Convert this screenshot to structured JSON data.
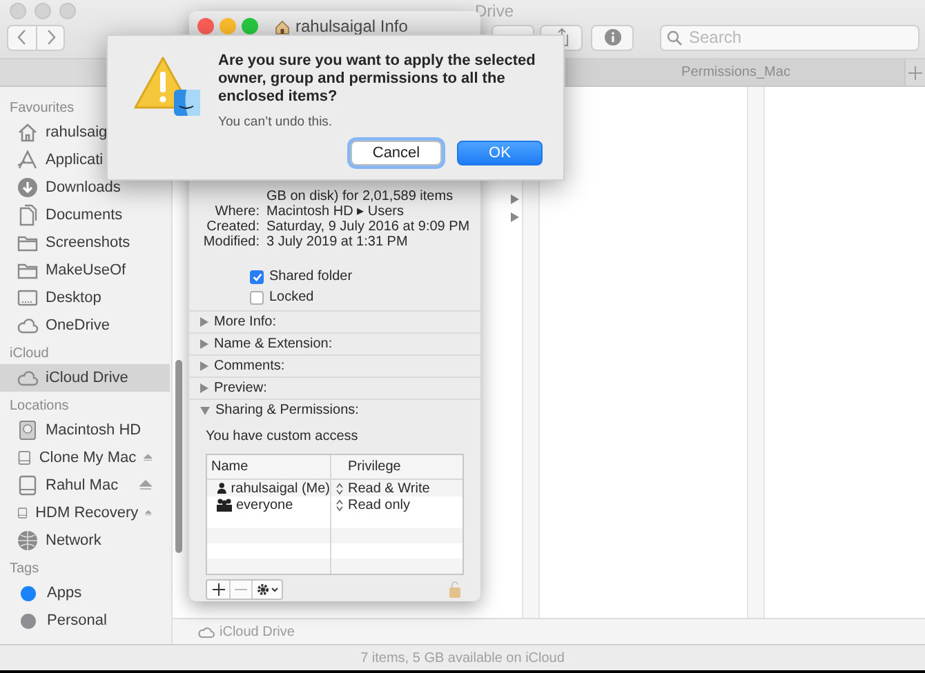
{
  "finder": {
    "title": "Drive",
    "search": {
      "placeholder": "Search"
    },
    "path_tab": "Permissions_Mac",
    "sidebar": [
      {
        "heading": "Favourites",
        "items": [
          {
            "label": "rahulsaig",
            "selected": false
          },
          {
            "label": "Applicati",
            "selected": false
          },
          {
            "label": "Downloads",
            "selected": false
          },
          {
            "label": "Documents",
            "selected": false
          },
          {
            "label": "Screenshots",
            "selected": false
          },
          {
            "label": "MakeUseOf",
            "selected": false
          },
          {
            "label": "Desktop",
            "selected": false
          },
          {
            "label": "OneDrive",
            "selected": false
          }
        ]
      },
      {
        "heading": "iCloud",
        "items": [
          {
            "label": "iCloud Drive",
            "selected": true
          }
        ]
      },
      {
        "heading": "Locations",
        "items": [
          {
            "label": "Macintosh HD",
            "selected": false,
            "ejectable": false
          },
          {
            "label": "Clone My Mac",
            "selected": false,
            "ejectable": true
          },
          {
            "label": "Rahul Mac",
            "selected": false,
            "ejectable": true
          },
          {
            "label": "HDM Recovery",
            "selected": false,
            "ejectable": true
          },
          {
            "label": "Network",
            "selected": false,
            "ejectable": false
          }
        ]
      },
      {
        "heading": "Tags",
        "items": [
          {
            "label": "Apps",
            "color": "#1a82fb",
            "selected": false
          },
          {
            "label": "Personal",
            "color": "#8e8e93",
            "selected": false
          }
        ]
      }
    ],
    "path_bar": "iCloud Drive",
    "status_bar": "7 items, 5 GB available on iCloud"
  },
  "info": {
    "title": "rahulsaigal Info",
    "details": [
      {
        "value": "GB on disk) for 2,01,589 items"
      },
      {
        "label": "Where:",
        "value": "Macintosh HD ▸ Users"
      },
      {
        "label": "Created:",
        "value": "Saturday, 9 July 2016 at 9:09 PM"
      },
      {
        "label": "Modified:",
        "value": "3 July 2019 at 1:31 PM"
      }
    ],
    "options": [
      {
        "label": "Shared folder",
        "checked": true
      },
      {
        "label": "Locked",
        "checked": false
      }
    ],
    "sections": [
      {
        "label": "More Info:",
        "expanded": false
      },
      {
        "label": "Name & Extension:",
        "expanded": false
      },
      {
        "label": "Comments:",
        "expanded": false
      },
      {
        "label": "Preview:",
        "expanded": false
      },
      {
        "label": "Sharing & Permissions:",
        "expanded": true
      }
    ],
    "access_note": "You have custom access",
    "permissions": {
      "columns": [
        "Name",
        "Privilege"
      ],
      "rows": [
        {
          "name": "rahulsaigal (Me)",
          "kind": "user",
          "privilege": "Read & Write"
        },
        {
          "name": "everyone",
          "kind": "group",
          "privilege": "Read only"
        }
      ]
    }
  },
  "alert": {
    "message": "Are you sure you want to apply the selected owner, group and permissions to all the enclosed items?",
    "note": "You can’t undo this.",
    "buttons": [
      {
        "label": "Cancel",
        "default": false
      },
      {
        "label": "OK",
        "default": true
      }
    ]
  }
}
